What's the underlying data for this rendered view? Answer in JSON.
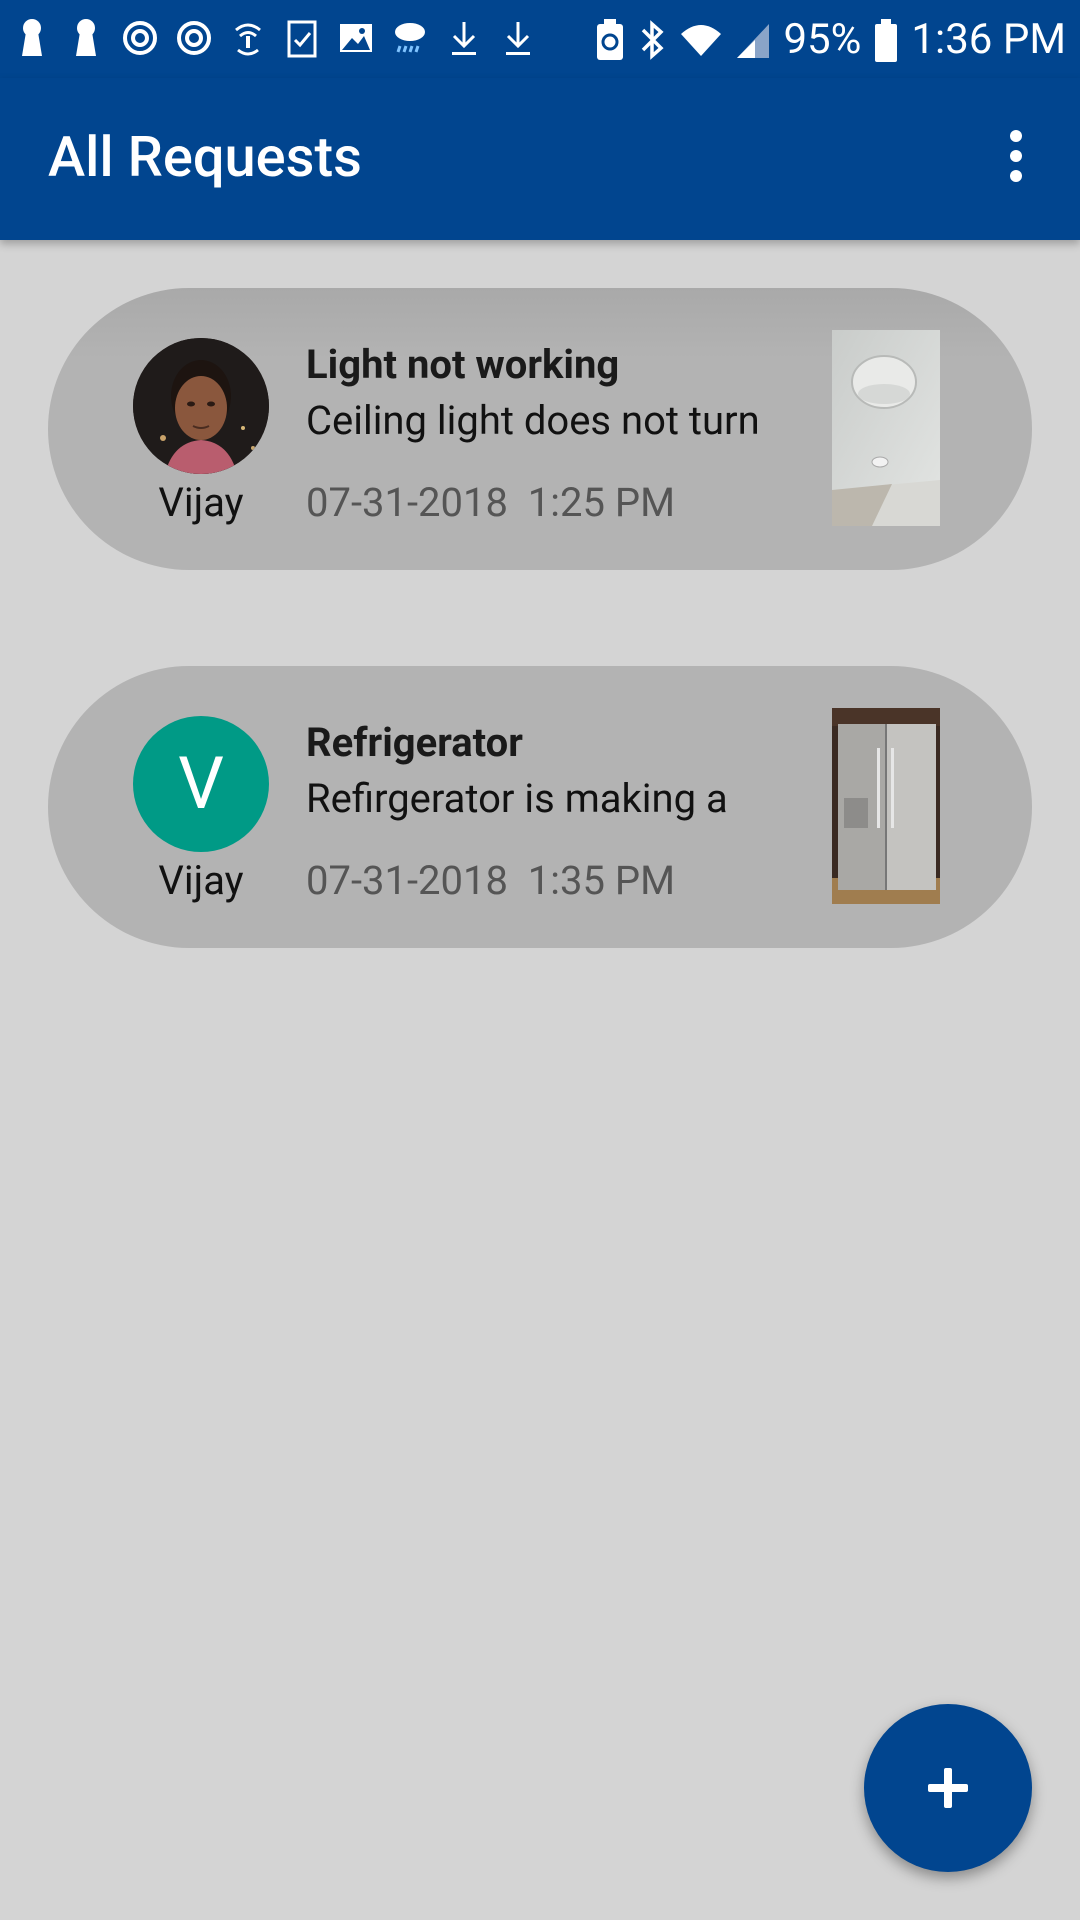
{
  "status_bar": {
    "battery_percent": "95%",
    "time": "1:36 PM",
    "left_icons": [
      "keyhole-icon",
      "keyhole-icon",
      "sync-icon",
      "sync-icon",
      "wifi-calling-icon",
      "checklist-icon",
      "gallery-icon",
      "weather-rain-icon",
      "download-icon",
      "download-icon"
    ],
    "right_icons": [
      "battery-saver-icon",
      "bluetooth-icon",
      "wifi-icon",
      "cell-signal-icon",
      "battery-icon"
    ]
  },
  "app_bar": {
    "title": "All Requests",
    "menu_icon": "overflow-menu-icon"
  },
  "requests": [
    {
      "title": "Light not working",
      "description": "Ceiling light does not turn",
      "author": "Vijay",
      "datetime": "07-31-2018  1:25 PM",
      "avatar_type": "photo",
      "thumbnail": "ceiling-light-photo"
    },
    {
      "title": "Refrigerator",
      "description": "Refirgerator is making a",
      "author": "Vijay",
      "datetime": "07-31-2018  1:35 PM",
      "avatar_type": "letter",
      "avatar_letter": "V",
      "avatar_color": "#009a86",
      "thumbnail": "refrigerator-photo"
    }
  ],
  "fab": {
    "icon": "plus-icon"
  },
  "colors": {
    "primary": "#01458f",
    "background": "#d4d4d4",
    "card": "#b3b3b3",
    "avatar_teal": "#009a86"
  }
}
